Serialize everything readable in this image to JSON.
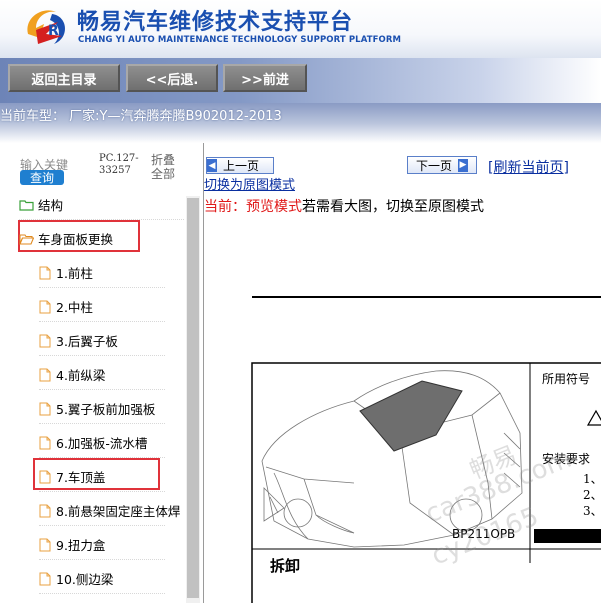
{
  "header": {
    "title": "畅易汽车维修技术支持平台",
    "subtitle": "CHANG YI AUTO MAINTENANCE TECHNOLOGY SUPPORT PLATFORM"
  },
  "nav": {
    "home": "返回主目录",
    "back": "<<后退.",
    "forward": ">>前进"
  },
  "vehicle": "当前车型： 厂家:Y—汽奔腾奔腾B902012-2013",
  "search": {
    "label": "输入关键",
    "button": "查询",
    "code": "PC.127-33257",
    "fold_all": "折叠全部"
  },
  "tree": {
    "root": "结构",
    "group": "车身面板更换",
    "items": [
      "1.前柱",
      "2.中柱",
      "3.后翼子板",
      "4.前纵梁",
      "5.翼子板前加强板",
      "6.加强板-流水槽",
      "7.车顶盖",
      "8.前悬架固定座主体焊",
      "9.扭力盒",
      "10.侧边梁"
    ]
  },
  "pager": {
    "prev": "上一页",
    "next": "下一页",
    "refresh": "[刷新当前页]"
  },
  "mode": {
    "switch_link": "切换为原图模式",
    "current_prefix": "当前：预览模式",
    "current_suffix": "若需看大图，切换至原图模式"
  },
  "diagram": {
    "symbols_label": "所用符号",
    "install_label": "安装要求",
    "install_items": [
      "1、",
      "2、",
      "3、"
    ],
    "part_code": "BP211OPB",
    "section": "拆卸",
    "watermark": [
      "畅易",
      "car388.com",
      "cy20165"
    ]
  },
  "colors": {
    "brand_blue": "#1a4fb0",
    "highlight_red": "#e0323a",
    "link_blue": "#0a2fa0"
  }
}
